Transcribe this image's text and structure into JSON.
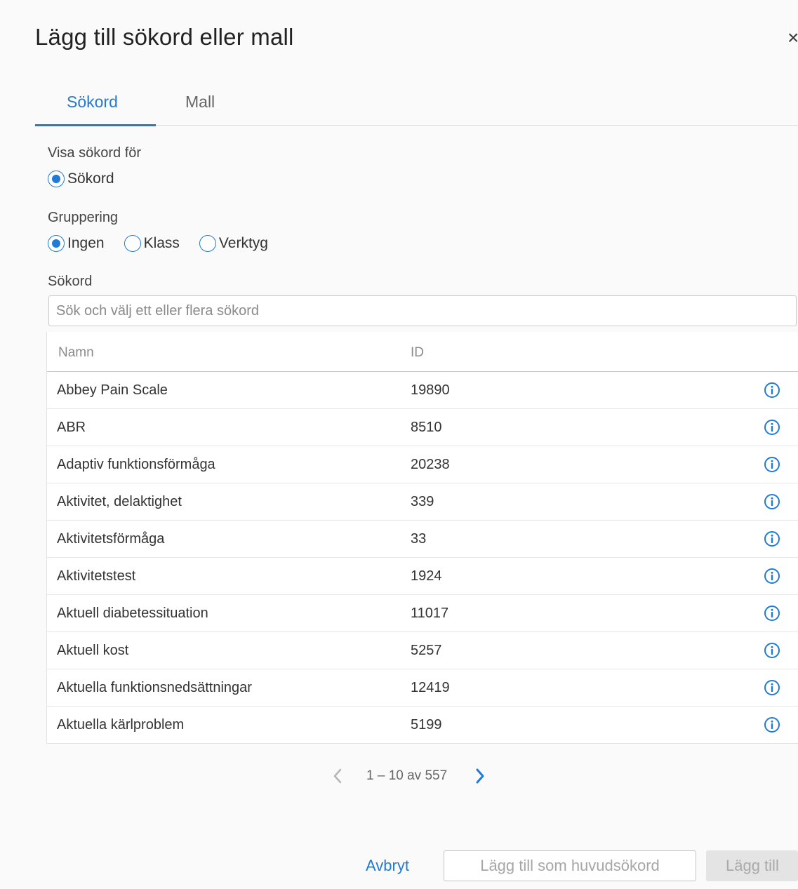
{
  "dialog": {
    "title": "Lägg till sökord eller mall",
    "close_symbol": "×"
  },
  "tabs": [
    {
      "label": "Sökord",
      "active": true
    },
    {
      "label": "Mall",
      "active": false
    }
  ],
  "visa": {
    "label": "Visa sökord för",
    "options": [
      {
        "label": "Sökord",
        "selected": true
      }
    ]
  },
  "gruppering": {
    "label": "Gruppering",
    "options": [
      {
        "label": "Ingen",
        "selected": true
      },
      {
        "label": "Klass",
        "selected": false
      },
      {
        "label": "Verktyg",
        "selected": false
      }
    ]
  },
  "search": {
    "label": "Sökord",
    "placeholder": "Sök och välj ett eller flera sökord",
    "value": ""
  },
  "table": {
    "columns": [
      "Namn",
      "ID"
    ],
    "rows": [
      {
        "name": "Abbey Pain Scale",
        "id": "19890"
      },
      {
        "name": "ABR",
        "id": "8510"
      },
      {
        "name": "Adaptiv funktionsförmåga",
        "id": "20238"
      },
      {
        "name": "Aktivitet, delaktighet",
        "id": "339"
      },
      {
        "name": "Aktivitetsförmåga",
        "id": "33"
      },
      {
        "name": "Aktivitetstest",
        "id": "1924"
      },
      {
        "name": "Aktuell diabetessituation",
        "id": "11017"
      },
      {
        "name": "Aktuell kost",
        "id": "5257"
      },
      {
        "name": "Aktuella funktionsnedsättningar",
        "id": "12419"
      },
      {
        "name": "Aktuella kärlproblem",
        "id": "5199"
      }
    ]
  },
  "pagination": {
    "range_text": "1 – 10 av 557"
  },
  "footer": {
    "cancel_label": "Avbryt",
    "add_main_label": "Lägg till som huvudsökord",
    "add_label": "Lägg till"
  },
  "colors": {
    "accent": "#1f7bd6",
    "disabled_text": "#a6a6a6",
    "background": "#fafafa"
  },
  "icons": {
    "row_action": "info-icon",
    "pager_prev": "chevron-left-icon",
    "pager_next": "chevron-right-icon",
    "close": "close-icon"
  }
}
